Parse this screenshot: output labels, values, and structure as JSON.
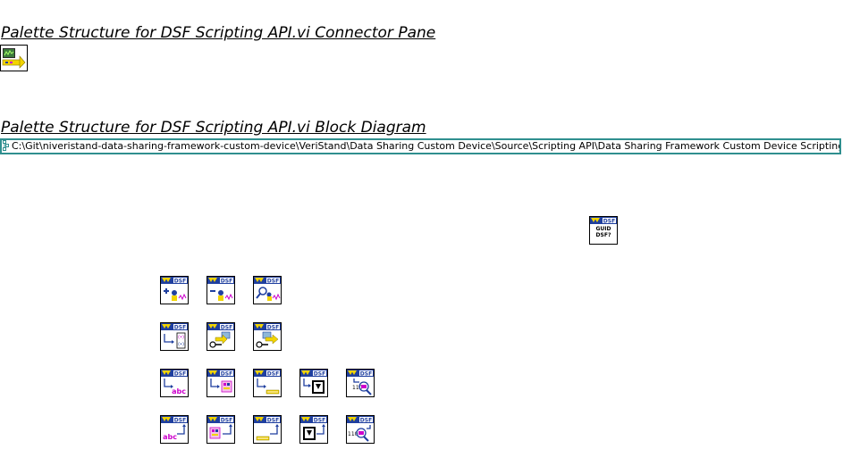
{
  "connector_pane": {
    "title": "Palette Structure for DSF Scripting API.vi Connector Pane",
    "icon": "palette-vi-icon"
  },
  "block_diagram": {
    "title": "Palette Structure for DSF Scripting API.vi Block Diagram",
    "path_constant": "C:\\Git\\niveristand-data-sharing-framework-custom-device\\VeriStand\\Data Sharing Custom Device\\Source\\Scripting API\\Data Sharing Framework Custom Device Scripting.lvlib",
    "guid_vi": {
      "icon": "guid-dsf-icon",
      "line1": "GUID",
      "line2": "DSF?"
    },
    "subvi_icons": [
      "add-custom-device-icon",
      "remove-custom-device-icon",
      "find-custom-device-icon",
      "get-channel-path-icon",
      "configure-engine-icon",
      "set-engine-config-icon",
      "get-string-icon",
      "get-cluster-icon",
      "get-numeric-icon",
      "get-boolean-icon",
      "get-path-icon",
      "set-string-icon",
      "set-cluster-icon",
      "set-numeric-icon",
      "set-boolean-icon",
      "set-path-icon"
    ]
  },
  "colors": {
    "path_border": "#2f8f8f",
    "ni_yellow": "#f2d400",
    "ni_blue": "#1f3f9f",
    "accent_magenta": "#cc00cc"
  }
}
